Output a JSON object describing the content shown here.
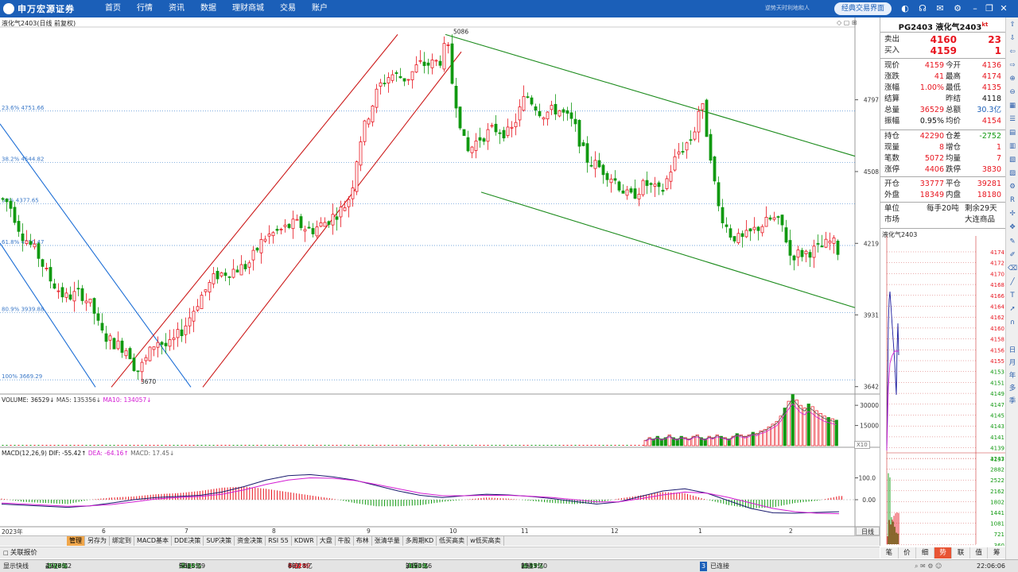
{
  "app": {
    "brand": "申万宏源证券",
    "menu": [
      "首页",
      "行情",
      "资讯",
      "数据",
      "理财商城",
      "交易",
      "账户"
    ],
    "slogan": "逆势天时利地和人",
    "classic_btn": "经典交易界面"
  },
  "chart_header": {
    "title": "液化气2403(日线 前复权)"
  },
  "period_label": "日线",
  "volume": {
    "legend_vol": "VOLUME: 36529↓",
    "legend_ma5": "MA5: 135356↓",
    "legend_ma10": "MA10: 134057↓",
    "ticks": [
      "30000",
      "15000"
    ],
    "x10": "X10"
  },
  "macd": {
    "legend_title": "MACD(12,26,9)",
    "legend_dif": "DIF: -55.42↑",
    "legend_dea": "DEA: -64.16↑",
    "legend_macd": "MACD: 17.45↓",
    "ticks": [
      "100.0",
      "0.00"
    ]
  },
  "x_labels": [
    "2023年",
    "6",
    "7",
    "8",
    "9",
    "10",
    "11",
    "12",
    "1",
    "2"
  ],
  "bottom_tabs": [
    "管理",
    "另存为",
    "绑定到",
    "MACD基本",
    "DDE决策",
    "SUP决策",
    "资金决策",
    "RSI 55",
    "KDWR",
    "大盘",
    "牛股",
    "布林",
    "张清华量",
    "多周期KD",
    "低买高卖",
    "w低买高卖"
  ],
  "assoc": {
    "label": "关联报价"
  },
  "status": {
    "display": "显示快线",
    "sh": {
      "name": "上证",
      "val": "2977.02",
      "chg": "-27.86",
      "pct": "-0.93%",
      "amt": "4276亿"
    },
    "sz": {
      "name": "深证",
      "val": "9066.09",
      "chg": "-3.33",
      "pct": "-0.04%",
      "amt": "5615亿"
    },
    "kc": {
      "name": "科创",
      "val": "768.49",
      "chg": "4.01",
      "pct": "0.52%",
      "amt": "697.8亿"
    },
    "hs": {
      "name": "沪深",
      "val": "3453.36",
      "chg": "-36.38",
      "pct": "-1.04%",
      "amt": "2390亿"
    },
    "cy": {
      "name": "创业",
      "val": "1751.70",
      "chg": "-6.49",
      "pct": "-0.37%",
      "amt": "2543亿"
    },
    "alerts": "3",
    "connected": "已连接",
    "time": "22:06:06"
  },
  "quote": {
    "code": "PG2403",
    "name": "液化气2403",
    "flag": "kt",
    "ask_label": "卖出",
    "ask_price": "4160",
    "ask_vol": "23",
    "bid_label": "买入",
    "bid_price": "4159",
    "bid_vol": "1",
    "rows1": [
      {
        "l1": "现价",
        "v1": "4159",
        "l2": "今开",
        "v2": "4136"
      },
      {
        "l1": "涨跌",
        "v1": "41",
        "l2": "最高",
        "v2": "4174"
      },
      {
        "l1": "涨幅",
        "v1": "1.00%",
        "l2": "最低",
        "v2": "4135"
      },
      {
        "l1": "结算",
        "v1": "",
        "l2": "昨结",
        "v2": "4118"
      },
      {
        "l1": "总量",
        "v1": "36529",
        "l2": "总额",
        "v2": "30.3亿"
      },
      {
        "l1": "振幅",
        "v1": "0.95%",
        "l2": "均价",
        "v2": "4154"
      }
    ],
    "rows2": [
      {
        "l1": "持仓",
        "v1": "42290",
        "l2": "仓差",
        "v2": "-2752"
      },
      {
        "l1": "现量",
        "v1": "8",
        "l2": "增仓",
        "v2": "1"
      },
      {
        "l1": "笔数",
        "v1": "5072",
        "l2": "均量",
        "v2": "7"
      },
      {
        "l1": "涨停",
        "v1": "4406",
        "l2": "跌停",
        "v2": "3830"
      }
    ],
    "rows3": [
      {
        "l1": "开仓",
        "v1": "33777",
        "l2": "平仓",
        "v2": "39281"
      },
      {
        "l1": "外盘",
        "v1": "18349",
        "l2": "内盘",
        "v2": "18180"
      }
    ],
    "unit_label": "单位",
    "unit_val": "每手20吨",
    "remain_val": "剩余29天",
    "market_label": "市场",
    "market_val": "大连商品"
  },
  "mini": {
    "label": "液化气2403",
    "ticks": [
      "4174",
      "4172",
      "4170",
      "4168",
      "4166",
      "4164",
      "4162",
      "4160",
      "4158",
      "4156",
      "4155",
      "4153",
      "4151",
      "4149",
      "4147",
      "4145",
      "4143",
      "4141",
      "4139",
      "4137",
      "3243",
      "2882",
      "2522",
      "2162",
      "1802",
      "1441",
      "1081",
      "721",
      "360"
    ],
    "tabs": [
      "笔",
      "价",
      "细",
      "势",
      "联",
      "值",
      "筹"
    ]
  },
  "sidebar_icons": [
    "up-arrow-icon",
    "down-arrow-icon",
    "left-arrow-icon",
    "right-arrow-icon",
    "zoom-in-icon",
    "zoom-out-icon",
    "grid-icon",
    "list-icon",
    "chart-icon",
    "layout-icon",
    "table-icon",
    "doc-icon",
    "settings-icon",
    "rsi-icon",
    "crosshair-icon",
    "move-icon",
    "pen-icon",
    "draw-icon",
    "eraser-icon",
    "line-icon",
    "text-icon",
    "cursor-icon",
    "magnet-icon"
  ],
  "sidebar_text": [
    "日",
    "月",
    "年",
    "多",
    "季"
  ],
  "chart_data": {
    "type": "candlestick",
    "title": "液化气2403(日线 前复权)",
    "y_ticks": [
      4797,
      4508,
      4219,
      3931,
      3642
    ],
    "y_range": [
      3625,
      5090
    ],
    "fib_levels": [
      {
        "label": "23.6% 4751.66",
        "value": 4751.66
      },
      {
        "label": "38.2% 4544.82",
        "value": 4544.82
      },
      {
        "label": "50% 4377.65",
        "value": 4377.65
      },
      {
        "label": "61.8% 4210.47",
        "value": 4210.47
      },
      {
        "label": "80.9% 3939.88",
        "value": 3939.88
      },
      {
        "label": "100% 3669.29",
        "value": 3669.29
      }
    ],
    "annotations": [
      {
        "text": "5086",
        "value": 5086
      },
      {
        "text": "3670",
        "value": 3670
      }
    ],
    "price_path": [
      [
        0,
        4400
      ],
      [
        10,
        4380
      ],
      [
        25,
        4260
      ],
      [
        45,
        4180
      ],
      [
        60,
        4080
      ],
      [
        80,
        4000
      ],
      [
        100,
        4020
      ],
      [
        115,
        3960
      ],
      [
        125,
        3860
      ],
      [
        140,
        3820
      ],
      [
        160,
        3790
      ],
      [
        170,
        3700
      ],
      [
        180,
        3740
      ],
      [
        195,
        3830
      ],
      [
        210,
        3800
      ],
      [
        230,
        3880
      ],
      [
        250,
        4000
      ],
      [
        270,
        4090
      ],
      [
        290,
        4110
      ],
      [
        310,
        4130
      ],
      [
        330,
        4240
      ],
      [
        350,
        4270
      ],
      [
        370,
        4300
      ],
      [
        390,
        4270
      ],
      [
        410,
        4310
      ],
      [
        430,
        4360
      ],
      [
        440,
        4420
      ],
      [
        450,
        4620
      ],
      [
        460,
        4720
      ],
      [
        475,
        4850
      ],
      [
        490,
        4900
      ],
      [
        510,
        4880
      ],
      [
        525,
        4940
      ],
      [
        540,
        4940
      ],
      [
        555,
        4960
      ],
      [
        560,
        5060
      ],
      [
        565,
        4900
      ],
      [
        575,
        4740
      ],
      [
        585,
        4580
      ],
      [
        600,
        4640
      ],
      [
        620,
        4680
      ],
      [
        640,
        4660
      ],
      [
        660,
        4820
      ],
      [
        680,
        4740
      ],
      [
        700,
        4760
      ],
      [
        720,
        4700
      ],
      [
        735,
        4560
      ],
      [
        750,
        4530
      ],
      [
        770,
        4480
      ],
      [
        790,
        4400
      ],
      [
        810,
        4460
      ],
      [
        830,
        4420
      ],
      [
        850,
        4580
      ],
      [
        870,
        4650
      ],
      [
        880,
        4800
      ],
      [
        885,
        4700
      ],
      [
        893,
        4560
      ],
      [
        900,
        4380
      ],
      [
        915,
        4260
      ],
      [
        930,
        4230
      ],
      [
        950,
        4280
      ],
      [
        970,
        4320
      ],
      [
        985,
        4280
      ],
      [
        990,
        4170
      ],
      [
        1010,
        4180
      ],
      [
        1030,
        4200
      ],
      [
        1045,
        4230
      ],
      [
        1055,
        4170
      ]
    ],
    "channels": [
      {
        "color": "#1e6fd6",
        "points": [
          [
            0,
            4700
          ],
          [
            240,
            3640
          ]
        ]
      },
      {
        "color": "#1e6fd6",
        "points": [
          [
            0,
            4220
          ],
          [
            120,
            3640
          ]
        ]
      },
      {
        "color": "#cc1a1a",
        "points": [
          [
            140,
            3640
          ],
          [
            500,
            5060
          ]
        ]
      },
      {
        "color": "#cc1a1a",
        "points": [
          [
            255,
            3640
          ],
          [
            580,
            4990
          ]
        ]
      },
      {
        "color": "#1a8a1a",
        "points": [
          [
            560,
            5060
          ],
          [
            1075,
            4570
          ]
        ]
      },
      {
        "color": "#1a8a1a",
        "points": [
          [
            605,
            4425
          ],
          [
            1075,
            3960
          ]
        ]
      }
    ],
    "volume_range": [
      0,
      36000
    ],
    "volume": [
      4,
      6,
      5,
      7,
      5,
      6,
      8,
      6,
      5,
      7,
      6,
      5,
      7,
      8,
      6,
      5,
      7,
      6,
      8,
      7,
      6,
      5,
      7,
      9,
      8,
      7,
      8,
      10,
      9,
      11,
      12,
      14,
      16,
      18,
      22,
      28,
      33,
      38,
      34,
      30,
      28,
      31,
      29,
      26,
      24,
      22,
      21,
      20,
      19
    ],
    "macd": {
      "dif": [
        -20,
        -25,
        -30,
        -35,
        -28,
        -15,
        0,
        10,
        15,
        20,
        35,
        60,
        90,
        110,
        115,
        105,
        90,
        65,
        40,
        20,
        10,
        18,
        25,
        22,
        15,
        5,
        -8,
        -20,
        -10,
        15,
        40,
        50,
        30,
        -5,
        -40,
        -60,
        -62,
        -58,
        -55
      ],
      "dea": [
        -15,
        -20,
        -25,
        -30,
        -28,
        -22,
        -10,
        3,
        10,
        15,
        25,
        45,
        70,
        90,
        100,
        98,
        88,
        70,
        50,
        30,
        18,
        18,
        20,
        20,
        16,
        10,
        0,
        -10,
        -10,
        5,
        22,
        35,
        30,
        10,
        -15,
        -40,
        -55,
        -62,
        -64
      ],
      "hist": [
        5,
        -10,
        -15,
        -20,
        0,
        10,
        15,
        25,
        30,
        40,
        55,
        60,
        50,
        35,
        20,
        5,
        -15,
        -30,
        -30,
        -25,
        -10,
        0,
        10,
        5,
        -5,
        -15,
        -20,
        -15,
        5,
        20,
        35,
        30,
        0,
        -25,
        -40,
        -35,
        -15,
        -5,
        17
      ],
      "range": [
        -120,
        200
      ]
    }
  }
}
